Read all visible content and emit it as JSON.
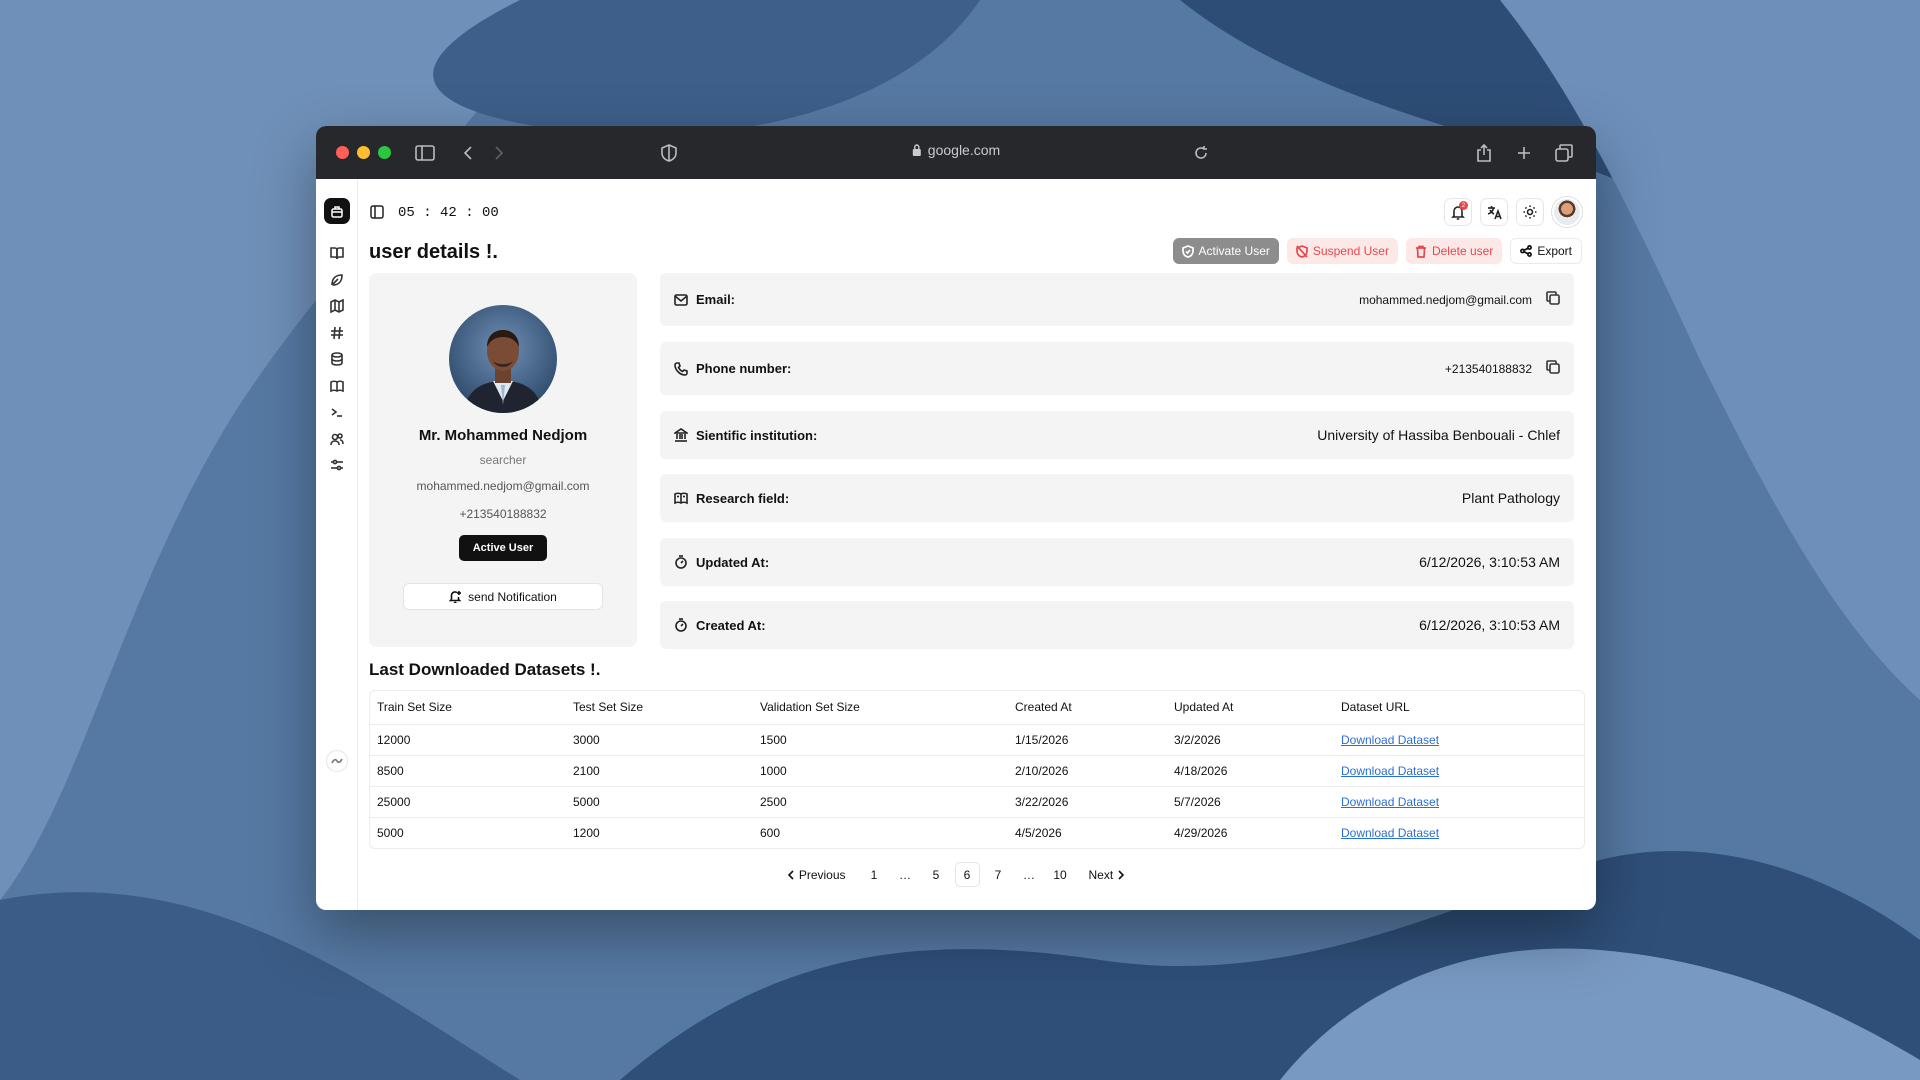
{
  "browser": {
    "url": "google.com"
  },
  "app": {
    "timer": "05 : 42 : 00",
    "page_title": "user details !.",
    "actions": {
      "activate": "Activate User",
      "suspend": "Suspend User",
      "delete": "Delete user",
      "export": "Export"
    },
    "notification_count": "2",
    "icons": [
      "sidebar-toggle-icon",
      "bell-icon",
      "translate-icon",
      "sun-icon"
    ]
  },
  "rail": {
    "icons": [
      "book-icon",
      "leaf-icon",
      "map-icon",
      "hash-icon",
      "database-icon",
      "book-open-icon",
      "terminal-icon",
      "users-icon",
      "sliders-icon"
    ]
  },
  "profile": {
    "name": "Mr. Mohammed Nedjom",
    "role": "searcher",
    "email": "mohammed.nedjom@gmail.com",
    "phone": "+213540188832",
    "status": "Active User",
    "notify_label": "send Notification"
  },
  "details": [
    {
      "label": "Email:",
      "value": "mohammed.nedjom@gmail.com",
      "icon": "mail-icon",
      "copy": true
    },
    {
      "label": "Phone number:",
      "value": "+213540188832",
      "icon": "phone-icon",
      "copy": true
    },
    {
      "label": "Sientific institution:",
      "value": "University of Hassiba Benbouali - Chlef",
      "icon": "institution-icon",
      "copy": false
    },
    {
      "label": "Research field:",
      "value": "Plant Pathology",
      "icon": "book-open-icon",
      "copy": false
    },
    {
      "label": "Updated At:",
      "value": "6/12/2026, 3:10:53 AM",
      "icon": "timer-icon",
      "copy": false
    },
    {
      "label": "Created At:",
      "value": "6/12/2026, 3:10:53 AM",
      "icon": "timer-icon",
      "copy": false
    }
  ],
  "datasets": {
    "title": "Last Downloaded Datasets !.",
    "columns": [
      "Train Set Size",
      "Test Set Size",
      "Validation Set Size",
      "Created At",
      "Updated At",
      "Dataset URL"
    ],
    "rows": [
      [
        "12000",
        "3000",
        "1500",
        "1/15/2026",
        "3/2/2026",
        "Download Dataset"
      ],
      [
        "8500",
        "2100",
        "1000",
        "2/10/2026",
        "4/18/2026",
        "Download Dataset"
      ],
      [
        "25000",
        "5000",
        "2500",
        "3/22/2026",
        "5/7/2026",
        "Download Dataset"
      ],
      [
        "5000",
        "1200",
        "600",
        "4/5/2026",
        "4/29/2026",
        "Download Dataset"
      ]
    ]
  },
  "pagination": {
    "previous": "Previous",
    "next": "Next",
    "pages": [
      "1",
      "…",
      "5",
      "6",
      "7",
      "…",
      "10"
    ],
    "current": "6"
  },
  "colors": {
    "accent_danger": "#e5484d",
    "link": "#2b6fd6",
    "primary": "#111111",
    "card_bg": "#f4f4f4"
  }
}
